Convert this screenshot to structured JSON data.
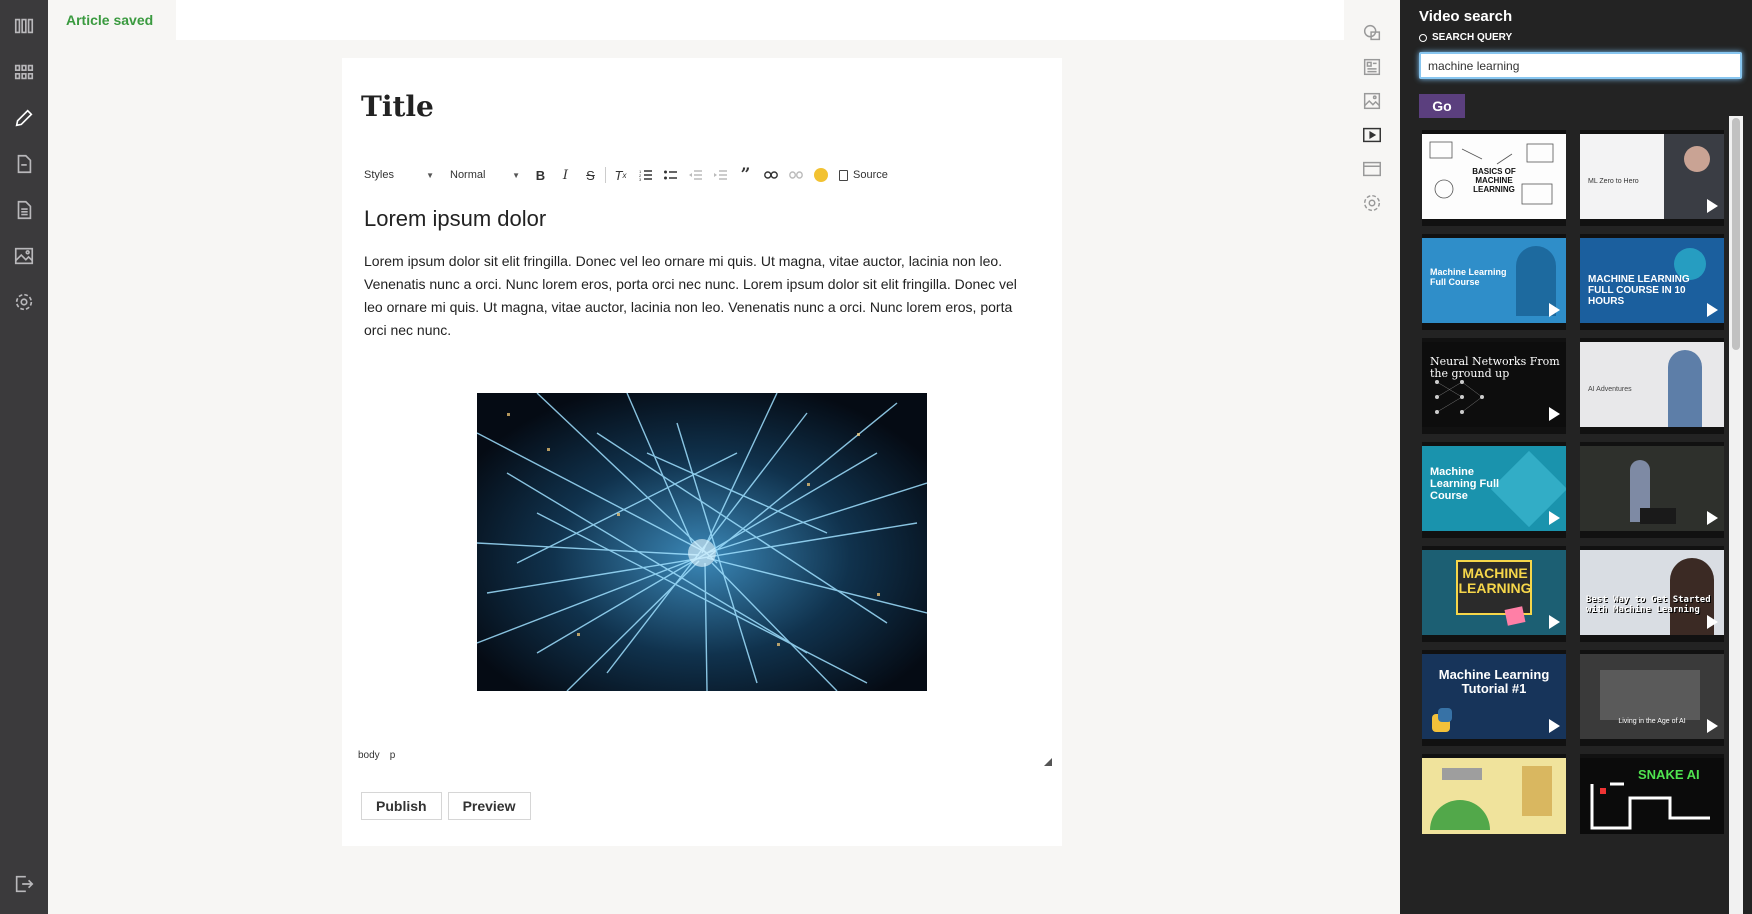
{
  "status": {
    "saved_label": "Article saved"
  },
  "editor": {
    "title": "Title",
    "toolbar": {
      "styles_label": "Styles",
      "format_label": "Normal",
      "source_label": "Source",
      "buttons": [
        "bold-icon",
        "italic-icon",
        "strikethrough-icon",
        "remove-format-icon",
        "numbered-list-icon",
        "bulleted-list-icon",
        "outdent-icon",
        "indent-icon",
        "blockquote-icon",
        "link-icon",
        "unlink-icon",
        "color-dot-icon"
      ]
    },
    "heading": "Lorem ipsum dolor",
    "paragraph": "Lorem ipsum dolor sit elit fringilla. Donec vel leo ornare mi quis.  Ut magna, vitae auctor, lacinia non leo. Venenatis nunc a orci. Nunc lorem eros, porta orci nec nunc. Lorem ipsum dolor sit elit fringilla. Donec vel leo ornare mi quis.  Ut magna, vitae auctor, lacinia non leo. Venenatis nunc a orci. Nunc lorem eros, porta orci nec nunc.",
    "path": [
      "body",
      "p"
    ],
    "publish_label": "Publish",
    "preview_label": "Preview"
  },
  "left_nav": [
    "columns-icon",
    "grid-icon",
    "pencil-icon",
    "document-icon",
    "article-icon",
    "image-icon",
    "gear-icon",
    "logout-icon"
  ],
  "right_strip": [
    "comments-icon",
    "newspaper-icon",
    "image-icon",
    "video-icon",
    "browser-icon",
    "gear-icon"
  ],
  "video_search": {
    "title": "Video search",
    "query_label": "SEARCH QUERY",
    "query_value": "machine learning",
    "go_label": "Go",
    "results": [
      {
        "text": "BASICS OF MACHINE LEARNING"
      },
      {
        "text": "ML Zero to Hero"
      },
      {
        "text": "Machine Learning Full Course"
      },
      {
        "text": "MACHINE LEARNING FULL COURSE IN 10 HOURS"
      },
      {
        "text": "Neural Networks From the ground up"
      },
      {
        "text": "AI Adventures"
      },
      {
        "text": "Machine Learning Full Course"
      },
      {
        "text": ""
      },
      {
        "text": "MACHINE LEARNING"
      },
      {
        "text": "Best Way to Get Started with Machine Learning"
      },
      {
        "text": "Machine Learning Tutorial #1"
      },
      {
        "text": "Living in the Age of AI"
      },
      {
        "text": ""
      },
      {
        "text": "SNAKE AI"
      }
    ]
  }
}
